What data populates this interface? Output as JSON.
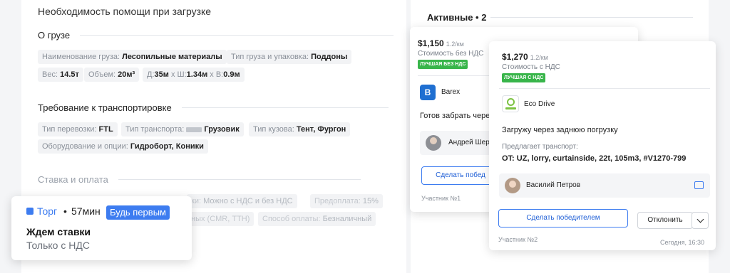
{
  "main": {
    "help_title": "Необходимость помощи при загрузке",
    "cargo_section": "О грузе",
    "cargo_chips": [
      {
        "k": "Наименование груза:",
        "v": "Лесопильные материалы"
      },
      {
        "k": "Тип груза и упаковка:",
        "v": "Поддоны"
      },
      {
        "k": "Вес:",
        "v": "14.5т"
      },
      {
        "k": "Объем:",
        "v": "20м³"
      },
      {
        "k": "Д:",
        "v": "35м",
        "k2": "х Ш:",
        "v2": "1.34м",
        "k3": "х В:",
        "v3": "0.9м"
      }
    ],
    "transport_section": "Требование к транспортировке",
    "transport_chips": [
      {
        "k": "Тип перевозки:",
        "v": "FTL"
      },
      {
        "k": "Тип транспорта:",
        "v": "Грузовик"
      },
      {
        "k": "Тип кузова:",
        "v": "Тент, Фургон"
      },
      {
        "k": "Оборудование и опции:",
        "v": "Гидроборт, Коники"
      }
    ],
    "rate_section": "Ставка и оплата",
    "rate_chips": [
      {
        "k": "ки:",
        "v": "Можно с НДС и без НДС"
      },
      {
        "k": "Предоплата:",
        "v": "15%"
      },
      {
        "k": "ных (CMR, ТТН)",
        "v": ""
      },
      {
        "k": "Способ оплаты:",
        "v": "Безналичный"
      }
    ]
  },
  "bid": {
    "type": "Торг",
    "time": "57мин",
    "badge": "Будь первым",
    "title": "Ждем ставки",
    "subtitle": "Только с НДС"
  },
  "active": {
    "title": "Активные • 2",
    "offers": [
      {
        "price": "$1,150",
        "unit": "1.2/км",
        "price_note": "Стоимость без НДС",
        "badge": "ЛУЧШАЯ БЕЗ НДС",
        "company": "Barex",
        "message": "Готов забрать чере",
        "person": "Андрей Шере",
        "win_label": "Сделать побед",
        "participant": "Участник №1"
      },
      {
        "price": "$1,270",
        "unit": "1.2/км",
        "price_note": "Стоимость с НДС",
        "badge": "ЛУЧШАЯ С НДС",
        "company": "Eco Drive",
        "message": "Загружу через заднюю погрузку",
        "transport_label": "Предлагает транспорт:",
        "transport": "OT: UZ, lorry, curtainside, 22t, 105m3, #V1270-799",
        "person": "Василий Петров",
        "win_label": "Сделать победителем",
        "reject_label": "Отклонить",
        "participant": "Участник №2",
        "time": "Сегодня, 16:30"
      }
    ]
  },
  "colors": {
    "accent": "#3d7cf0",
    "green": "#38b54a",
    "barex": "#1f6fd1"
  }
}
